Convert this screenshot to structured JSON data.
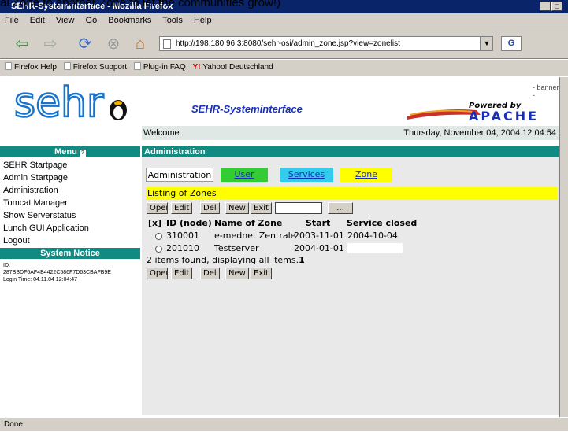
{
  "window": {
    "title": "SEHR-Systeminterface - Mozilla Firefox",
    "caption_above": "al Zone to another Zone to let the communities grow!)"
  },
  "menubar": [
    "File",
    "Edit",
    "View",
    "Go",
    "Bookmarks",
    "Tools",
    "Help"
  ],
  "navbar": {
    "url": "http://198.180.96.3:8080/sehr-osi/admin_zone.jsp?view=zonelist"
  },
  "bookmarks": [
    "Firefox Help",
    "Firefox Support",
    "Plug-in FAQ",
    "Yahoo! Deutschland"
  ],
  "header": {
    "title": "SEHR-Systeminterface",
    "banner": "- banner -",
    "powered": "Powered by",
    "apache": "APACHE"
  },
  "welcome": {
    "text": "Welcome",
    "datetime": "Thursday, November 04, 2004 12:04:54"
  },
  "sidebar": {
    "menu_title": "Menu",
    "items": [
      "SEHR Startpage",
      "Admin Startpage",
      "Administration",
      "Tomcat Manager",
      "Show Serverstatus",
      "Lunch GUI Application",
      "Logout"
    ],
    "notice_title": "System Notice",
    "notice_id_label": "ID:",
    "notice_id": "287BBDF6AF4B4422C586F7D63CBAFB9E",
    "notice_login": "Login Time: 04.11.04 12:04:47"
  },
  "main": {
    "heading": "Administration",
    "tabs": [
      {
        "label": "Administration",
        "color": "#ffffff"
      },
      {
        "label": "User",
        "color": "#33cc33"
      },
      {
        "label": "Services",
        "color": "#33ccee"
      },
      {
        "label": "Zone",
        "color": "#ffff00"
      }
    ],
    "listing": "Listing of Zones",
    "buttons": [
      "Open",
      "Edit",
      "Del",
      "New",
      "Exit"
    ],
    "browse": "...",
    "columns": [
      "[x]",
      "ID (node)",
      "Name of Zone",
      "Start",
      "Service closed"
    ],
    "rows": [
      {
        "id": "310001",
        "name": "e-mednet Zentrale",
        "start": "2003-11-01",
        "closed": "2004-10-04"
      },
      {
        "id": "201010",
        "name": "Testserver",
        "start": "2004-01-01",
        "closed": ""
      }
    ],
    "found": "2 items found, displaying all items.",
    "page": "1"
  },
  "status": "Done"
}
